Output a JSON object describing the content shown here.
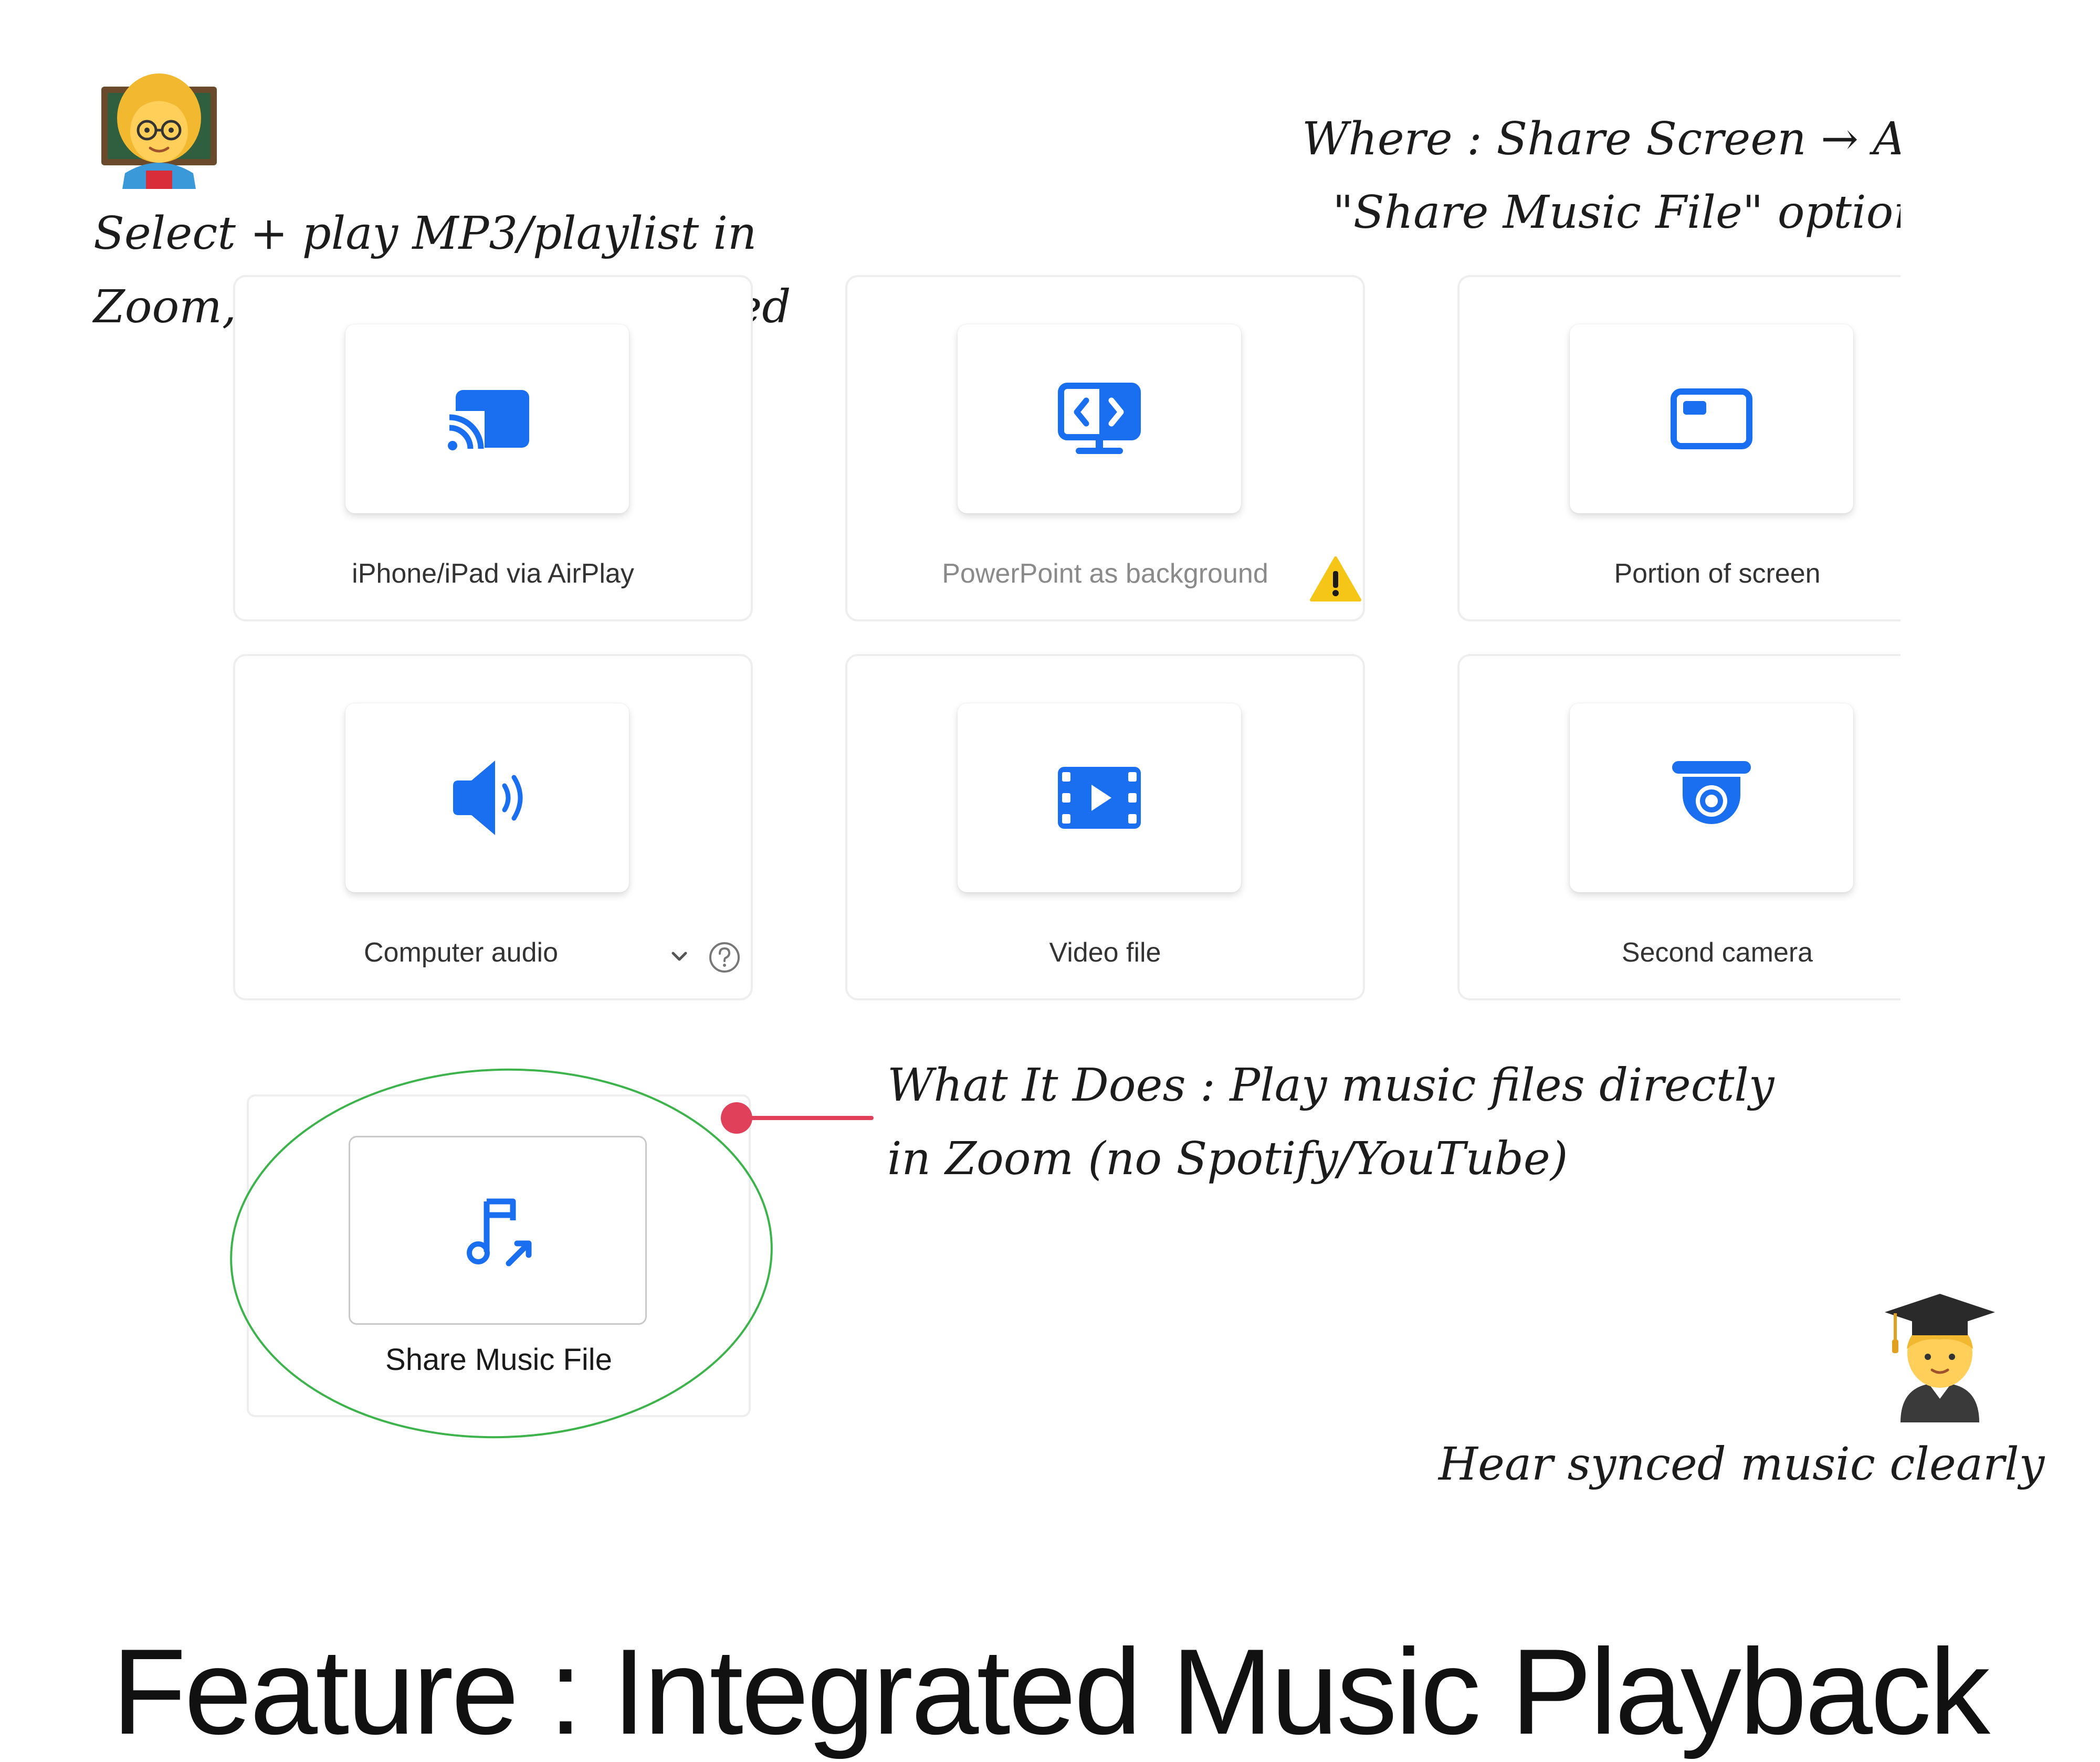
{
  "annotations": {
    "left_note": [
      "Select + play MP3/playlist in",
      "Zoom, no external app needed"
    ],
    "where_note": [
      "Where : Share Screen → Add",
      "\"Share Music File\" option"
    ],
    "what_note": [
      "What It Does : Play music files directly",
      "in Zoom (no Spotify/YouTube)"
    ],
    "student_note": "Hear synced music clearly"
  },
  "share_options": [
    {
      "label": "iPhone/iPad via AirPlay",
      "icon": "airplay-cast-icon"
    },
    {
      "label": "PowerPoint as background",
      "icon": "powerpoint-background-icon",
      "warning": true
    },
    {
      "label": "Portion of screen",
      "icon": "screen-portion-icon"
    },
    {
      "label": "Computer audio",
      "icon": "speaker-icon",
      "has_dropdown": true,
      "has_help": true
    },
    {
      "label": "Video file",
      "icon": "video-film-icon"
    },
    {
      "label": "Second camera",
      "icon": "camera-icon"
    }
  ],
  "featured_option": {
    "label": "Share Music File",
    "icon": "music-share-icon"
  },
  "footer_title": "Feature : Integrated Music Playback",
  "colors": {
    "accent_blue": "#1a6ef0",
    "warning_yellow": "#f5c518",
    "highlight_circle": "#3cb44b",
    "pointer_red": "#e0405a"
  }
}
